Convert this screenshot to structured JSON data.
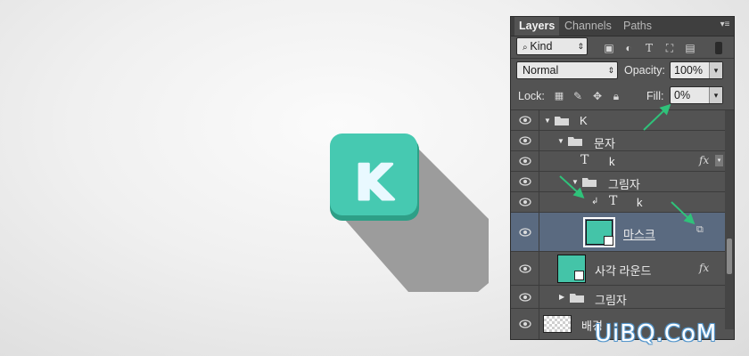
{
  "illustration": {
    "letter": "K",
    "colors": {
      "tile": "#46c9b1",
      "tile_edge": "#2e9f87",
      "letter": "#e9f9ff",
      "long_shadow": "#9c9c9c"
    }
  },
  "panel": {
    "tabs": [
      "Layers",
      "Channels",
      "Paths"
    ],
    "active_tab": "Layers",
    "menu_icon": "panel-menu-icon",
    "filter": {
      "kind_label": "Kind",
      "icons": [
        "image-filter-icon",
        "adjustment-filter-icon",
        "type-filter-icon",
        "shape-filter-icon",
        "smart-object-filter-icon",
        "filter-toggle-icon"
      ]
    },
    "blend_mode": "Normal",
    "opacity_label": "Opacity:",
    "opacity_value": "100%",
    "lock_label": "Lock:",
    "lock_icons": [
      "lock-transparent-icon",
      "lock-image-icon",
      "lock-position-icon",
      "lock-all-icon"
    ],
    "fill_label": "Fill:",
    "fill_value": "0%",
    "layers": [
      {
        "name": "K",
        "kind": "group",
        "expanded": true,
        "depth": 0
      },
      {
        "name": "문자",
        "kind": "group",
        "expanded": true,
        "depth": 1
      },
      {
        "name": "k",
        "kind": "text",
        "depth": 2,
        "fx": "fx"
      },
      {
        "name": "그림자",
        "kind": "group",
        "expanded": true,
        "depth": 2
      },
      {
        "name": "k",
        "kind": "text",
        "depth": 3,
        "clipped": true
      },
      {
        "name": "마스크",
        "kind": "shape",
        "depth": 3,
        "selected": true
      },
      {
        "name": "사각 라운드",
        "kind": "shape",
        "depth": 1,
        "fx": "fx"
      },
      {
        "name": "그림자",
        "kind": "group",
        "expanded": false,
        "depth": 1
      },
      {
        "name": "배경",
        "kind": "background",
        "depth": 0
      }
    ],
    "colors": {
      "panel_bg": "#535353",
      "selected_row": "#5a6a80",
      "annotation_arrow": "#2fc27a",
      "thumb": "#44c4a8"
    }
  },
  "watermark": "UiBQ.CoM"
}
